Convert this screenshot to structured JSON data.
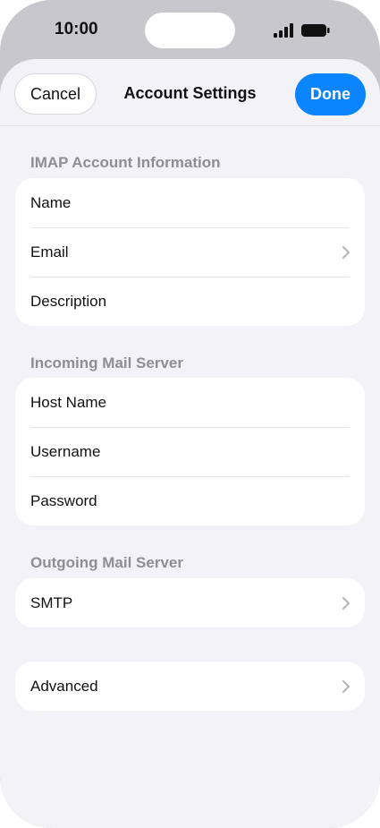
{
  "status_bar": {
    "time": "10:00",
    "signal_icon": "cellular-signal-icon",
    "battery_icon": "battery-icon"
  },
  "nav": {
    "cancel_label": "Cancel",
    "title": "Account Settings",
    "done_label": "Done"
  },
  "sections": {
    "imap": {
      "header": "IMAP Account Information",
      "rows": [
        "Name",
        "Email",
        "Description"
      ]
    },
    "incoming": {
      "header": "Incoming Mail Server",
      "rows": [
        "Host Name",
        "Username",
        "Password"
      ]
    },
    "outgoing": {
      "header": "Outgoing Mail Server",
      "rows": [
        "SMTP"
      ]
    },
    "advanced": {
      "rows": [
        "Advanced"
      ]
    }
  },
  "colors": {
    "accent": "#0a84ff",
    "background": "#f2f2f7",
    "section_header": "#8e8e93"
  }
}
